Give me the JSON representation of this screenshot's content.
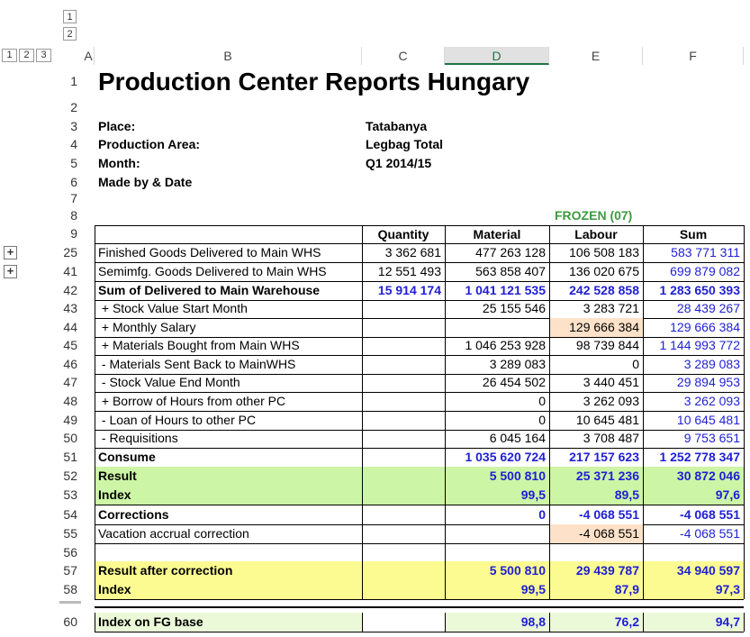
{
  "outline": {
    "row_levels": [
      "1",
      "2"
    ],
    "col_levels": [
      "1",
      "2",
      "3"
    ],
    "expand_symbol": "+"
  },
  "columns": [
    "A",
    "B",
    "C",
    "D",
    "E",
    "F"
  ],
  "sheet": {
    "title": "Production Center Reports Hungary",
    "info": [
      {
        "label": "Place:",
        "value": "Tatabanya"
      },
      {
        "label": "Production Area:",
        "value": "Legbag Total"
      },
      {
        "label": "Month:",
        "value": "Q1 2014/15"
      },
      {
        "label": "Made by & Date",
        "value": ""
      }
    ],
    "frozen_label": "FROZEN (07)",
    "headers": {
      "quantity": "Quantity",
      "material": "Material",
      "labour": "Labour",
      "sum": "Sum"
    },
    "rows": [
      {
        "n": "25",
        "label": "Finished Goods Delivered to Main WHS",
        "q": "3 362 681",
        "m": "477 263 128",
        "l": "106 508 183",
        "s": "583 771 311"
      },
      {
        "n": "41",
        "label": "Semimfg. Goods Delivered to Main WHS",
        "q": "12 551 493",
        "m": "563 858 407",
        "l": "136 020 675",
        "s": "699 879 082"
      },
      {
        "n": "42",
        "label": "Sum of Delivered to Main Warehouse",
        "q": "15 914 174",
        "m": "1 041 121 535",
        "l": "242 528 858",
        "s": "1 283 650 393"
      },
      {
        "n": "43",
        "label": " + Stock Value Start Month",
        "q": "",
        "m": "25 155 546",
        "l": "3 283 721",
        "s": "28 439 267"
      },
      {
        "n": "44",
        "label": " + Monthly Salary",
        "q": "",
        "m": "",
        "l": "129 666 384",
        "s": "129 666 384"
      },
      {
        "n": "45",
        "label": " + Materials Bought from Main WHS",
        "q": "",
        "m": "1 046 253 928",
        "l": "98 739 844",
        "s": "1 144 993 772"
      },
      {
        "n": "46",
        "label": " - Materials Sent Back to MainWHS",
        "q": "",
        "m": "3 289 083",
        "l": "0",
        "s": "3 289 083"
      },
      {
        "n": "47",
        "label": " - Stock Value End Month",
        "q": "",
        "m": "26 454 502",
        "l": "3 440 451",
        "s": "29 894 953"
      },
      {
        "n": "48",
        "label": " + Borrow of Hours from other PC",
        "q": "",
        "m": "0",
        "l": "3 262 093",
        "s": "3 262 093"
      },
      {
        "n": "49",
        "label": " - Loan of Hours to other PC",
        "q": "",
        "m": "0",
        "l": "10 645 481",
        "s": "10 645 481"
      },
      {
        "n": "50",
        "label": " - Requisitions",
        "q": "",
        "m": "6 045 164",
        "l": "3 708 487",
        "s": "9 753 651"
      },
      {
        "n": "51",
        "label": "Consume",
        "q": "",
        "m": "1 035 620 724",
        "l": "217 157 623",
        "s": "1 252 778 347"
      },
      {
        "n": "52",
        "label": "Result",
        "q": "",
        "m": "5 500 810",
        "l": "25 371 236",
        "s": "30 872 046"
      },
      {
        "n": "53",
        "label": "Index",
        "q": "",
        "m": "99,5",
        "l": "89,5",
        "s": "97,6"
      },
      {
        "n": "54",
        "label": "Corrections",
        "q": "",
        "m": "0",
        "l": "-4 068 551",
        "s": "-4 068 551"
      },
      {
        "n": "55",
        "label": "Vacation accrual correction",
        "q": "",
        "m": "",
        "l": "-4 068 551",
        "s": "-4 068 551"
      },
      {
        "n": "56",
        "label": "",
        "q": "",
        "m": "",
        "l": "",
        "s": ""
      },
      {
        "n": "57",
        "label": "Result after correction",
        "q": "",
        "m": "5 500 810",
        "l": "29 439 787",
        "s": "34 940 597"
      },
      {
        "n": "58",
        "label": "Index",
        "q": "",
        "m": "99,5",
        "l": "87,9",
        "s": "97,3"
      },
      {
        "n": "60",
        "label": "Index on FG base",
        "q": "",
        "m": "98,8",
        "l": "76,2",
        "s": "94,7"
      }
    ]
  }
}
